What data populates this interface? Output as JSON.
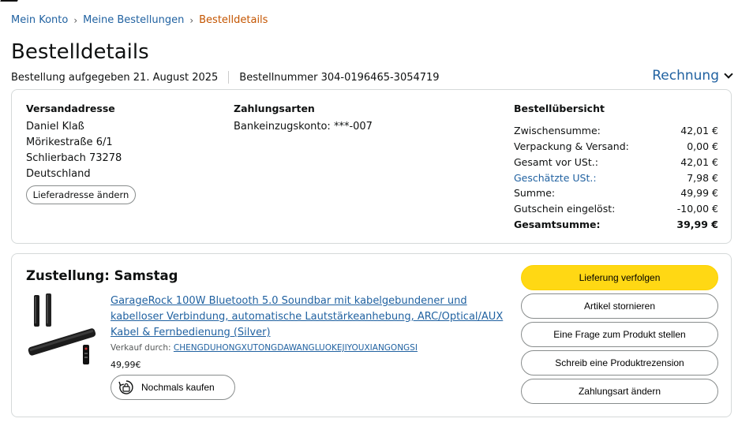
{
  "breadcrumb": {
    "items": [
      "Mein Konto",
      "Meine Bestellungen"
    ],
    "current": "Bestelldetails",
    "separator": "›"
  },
  "page_title": "Bestelldetails",
  "order_meta": {
    "placed": "Bestellung aufgegeben 21. August 2025",
    "number": "Bestellnummer 304-0196465-3054719"
  },
  "invoice_label": "Rechnung",
  "shipping": {
    "title": "Versandadresse",
    "lines": [
      "Daniel Klaß",
      "Mörikestraße 6/1",
      "Schlierbach 73278",
      "Deutschland"
    ],
    "change_button": "Lieferadresse ändern"
  },
  "payment": {
    "title": "Zahlungsarten",
    "method": "Bankeinzugskonto: ***-007"
  },
  "summary": {
    "title": "Bestellübersicht",
    "rows": [
      {
        "label": "Zwischensumme:",
        "value": "42,01 €"
      },
      {
        "label": "Verpackung & Versand:",
        "value": "0,00 €"
      },
      {
        "label": "Gesamt vor USt.:",
        "value": "42,01 €"
      },
      {
        "label": "Geschätzte USt.:",
        "value": "7,98 €"
      },
      {
        "label": "Summe:",
        "value": "49,99 €"
      },
      {
        "label": "Gutschein eingelöst:",
        "value": "-10,00 €"
      }
    ],
    "total_label": "Gesamtsumme:",
    "total_value": "39,99 €"
  },
  "delivery": {
    "title": "Zustellung: Samstag",
    "product_title": "GarageRock 100W Bluetooth 5.0 Soundbar mit kabelgebundener und kabelloser Verbindung, automatische Lautstärkeanhebung, ARC/Optical/AUX Kabel & Fernbedienung (Silver)",
    "seller_prefix": "Verkauf durch: ",
    "seller_name": "CHENGDUHONGXUTONGDAWANGLUOKEJIYOUXIANGONGSI",
    "price": "49,99€",
    "rebuy_button": "Nochmals kaufen"
  },
  "actions": {
    "track": "Lieferung verfolgen",
    "cancel": "Artikel stornieren",
    "question": "Eine Frage zum Produkt stellen",
    "review": "Schreib eine Produktrezension",
    "payment_change": "Zahlungsart ändern"
  },
  "colors": {
    "link": "#2162a1",
    "breadcrumb_current": "#c45500",
    "primary_button": "#ffd814",
    "border": "#d5d9d9"
  },
  "icons": {
    "invoice_chevron": "chevron-down-icon",
    "rebuy": "rebuy-icon"
  }
}
